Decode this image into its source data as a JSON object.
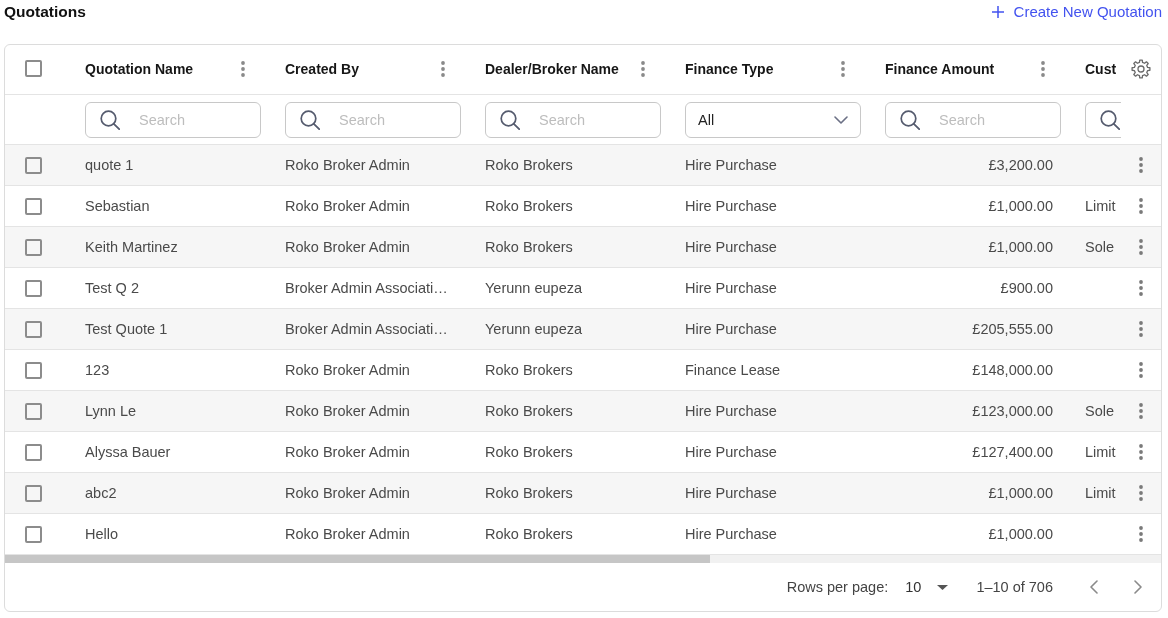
{
  "header": {
    "title": "Quotations",
    "create_button": {
      "label": "Create New Quotation"
    }
  },
  "table": {
    "select_all": {
      "checked": false
    },
    "columns": [
      {
        "label": "Quotation Name",
        "has_menu": true,
        "filter": {
          "kind": "search",
          "placeholder": "Search"
        }
      },
      {
        "label": "Created By",
        "has_menu": true,
        "filter": {
          "kind": "search",
          "placeholder": "Search"
        }
      },
      {
        "label": "Dealer/Broker Name",
        "has_menu": true,
        "filter": {
          "kind": "search",
          "placeholder": "Search"
        }
      },
      {
        "label": "Finance Type",
        "has_menu": true,
        "filter": {
          "kind": "select",
          "value": "All"
        }
      },
      {
        "label": "Finance Amount",
        "has_menu": true,
        "filter": {
          "kind": "search",
          "placeholder": "Search"
        }
      },
      {
        "label": "Cust",
        "has_menu": false,
        "filter": {
          "kind": "search"
        }
      }
    ],
    "rows": [
      {
        "checked": false,
        "quotation_name": "quote 1",
        "created_by": "Roko Broker Admin",
        "dealer_broker_name": "Roko Brokers",
        "finance_type": "Hire Purchase",
        "finance_amount": "£3,200.00"
      },
      {
        "checked": false,
        "quotation_name": "Sebastian",
        "created_by": "Roko Broker Admin",
        "dealer_broker_name": "Roko Brokers",
        "finance_type": "Hire Purchase",
        "finance_amount": "£1,000.00",
        "column_6": "Limit"
      },
      {
        "checked": false,
        "quotation_name": "Keith Martinez",
        "created_by": "Roko Broker Admin",
        "dealer_broker_name": "Roko Brokers",
        "finance_type": "Hire Purchase",
        "finance_amount": "£1,000.00",
        "column_6": "Sole"
      },
      {
        "checked": false,
        "quotation_name": "Test Q 2",
        "created_by": "Broker Admin Associati…",
        "dealer_broker_name": "Yerunn eupeza",
        "finance_type": "Hire Purchase",
        "finance_amount": "£900.00"
      },
      {
        "checked": false,
        "quotation_name": "Test Quote 1",
        "created_by": "Broker Admin Associati…",
        "dealer_broker_name": "Yerunn eupeza",
        "finance_type": "Hire Purchase",
        "finance_amount": "£205,555.00"
      },
      {
        "checked": false,
        "quotation_name": "123",
        "created_by": "Roko Broker Admin",
        "dealer_broker_name": "Roko Brokers",
        "finance_type": "Finance Lease",
        "finance_amount": "£148,000.00"
      },
      {
        "checked": false,
        "quotation_name": "Lynn Le",
        "created_by": "Roko Broker Admin",
        "dealer_broker_name": "Roko Brokers",
        "finance_type": "Hire Purchase",
        "finance_amount": "£123,000.00",
        "column_6": "Sole"
      },
      {
        "checked": false,
        "quotation_name": "Alyssa Bauer",
        "created_by": "Roko Broker Admin",
        "dealer_broker_name": "Roko Brokers",
        "finance_type": "Hire Purchase",
        "finance_amount": "£127,400.00",
        "column_6": "Limit"
      },
      {
        "checked": false,
        "quotation_name": "abc2",
        "created_by": "Roko Broker Admin",
        "dealer_broker_name": "Roko Brokers",
        "finance_type": "Hire Purchase",
        "finance_amount": "£1,000.00",
        "column_6": "Limit"
      },
      {
        "checked": false,
        "quotation_name": "Hello",
        "created_by": "Roko Broker Admin",
        "dealer_broker_name": "Roko Brokers",
        "finance_type": "Hire Purchase",
        "finance_amount": "£1,000.00"
      }
    ]
  },
  "pagination": {
    "rows_per_page_label": "Rows per page:",
    "rows_per_page": "10",
    "range": "1–10 of 706"
  }
}
